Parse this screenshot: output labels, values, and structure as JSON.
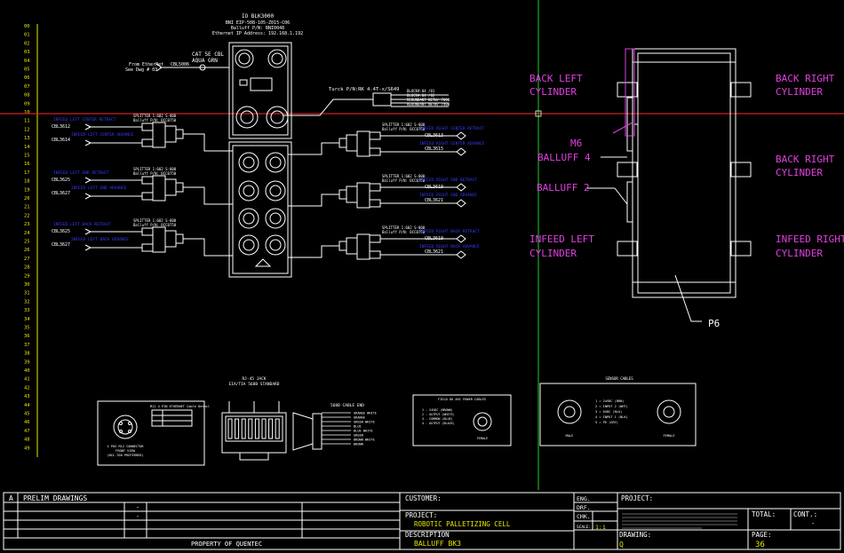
{
  "rows": [
    "00",
    "01",
    "02",
    "03",
    "04",
    "05",
    "06",
    "07",
    "08",
    "09",
    "10",
    "11",
    "12",
    "13",
    "14",
    "15",
    "16",
    "17",
    "18",
    "19",
    "20",
    "21",
    "22",
    "23",
    "24",
    "25",
    "26",
    "27",
    "28",
    "29",
    "30",
    "31",
    "32",
    "33",
    "34",
    "35",
    "36",
    "37",
    "38",
    "39",
    "40",
    "41",
    "42",
    "43",
    "44",
    "45",
    "46",
    "47",
    "48",
    "49"
  ],
  "block_header": [
    "IO BLK3000",
    "BNI EIP-508-105-Z015-C06",
    "Balluff P/N: BNI0048",
    "Ethernet IP Address: 192.168.1.192"
  ],
  "cat_cable": [
    "CAT 5E CBL",
    "AQUA GRN"
  ],
  "from_enet": [
    "From EtherNet",
    "See Dwg # 03"
  ],
  "from_cbl": "CBL5006",
  "turck_cable": "Turck P/N:RK 4.4T-x/S649",
  "turck_notes": [
    "BLOCK#:04 /01",
    "BLOCK#:04 /02",
    "REDUNDANT NETW/ 7000",
    "REDUNDANT NETW/ 7400"
  ],
  "left_groups": [
    {
      "splitter": "SPLITTER 1:602 S-800",
      "pn": "Balluff P/N: BCC0750",
      "desc1": "INFEED LEFT CENTER RETRACT",
      "cbl1": "CBL3612",
      "desc2": "INFEED LEFT CENTER ADVANCE",
      "cbl2": "CBL3614"
    },
    {
      "splitter": "SPLITTER 1:602 S-800",
      "pn": "Balluff P/N: BCC0750",
      "desc1": "INFEED LEFT END RETRACT",
      "cbl1": "CBL3625",
      "desc2": "INFEED LEFT END ADVANCE",
      "cbl2": "CBL3627"
    },
    {
      "splitter": "SPLITTER 1:602 S-800",
      "pn": "Balluff P/N: BCC0750",
      "desc1": "INFEED LEFT BACK RETRACT",
      "cbl1": "CBL3625",
      "desc2": "INFEED LEFT BACK ADVANCE",
      "cbl2": "CBL3627"
    }
  ],
  "right_groups": [
    {
      "splitter": "SPLITTER 1:602 S-800",
      "pn": "Balluff P/N: BCC0750",
      "desc1": "INFEED RIGHT CENTER RETRACT",
      "cbl1": "CBL3613",
      "desc2": "INFEED RIGHT CENTER ADVANCE",
      "cbl2": "CBL3615"
    },
    {
      "splitter": "SPLITTER 1:602 S-800",
      "pn": "Balluff P/N: BCC0750",
      "desc1": "INFEED RIGHT END RETRACT",
      "cbl1": "CBL3619",
      "desc2": "INFEED RIGHT END ADVANCE",
      "cbl2": "CBL3621"
    },
    {
      "splitter": "SPLITTER 1:602 S-800",
      "pn": "Balluff P/N: BCC0750",
      "desc1": "INFEED RIGHT BACK RETRACT",
      "cbl1": "CBL3619",
      "desc2": "INFEED RIGHT BACK ADVANCE",
      "cbl2": "CBL3621"
    }
  ],
  "pallet_labels": {
    "back_left": [
      "BACK LEFT",
      "CYLINDER"
    ],
    "back_right": [
      "BACK RIGHT",
      "CYLINDER"
    ],
    "back_right2": [
      "BACK RIGHT",
      "CYLINDER"
    ],
    "infeed_left": [
      "INFEED LEFT",
      "CYLINDER"
    ],
    "infeed_right": [
      "INFEED RIGHT",
      "CYLINDER"
    ],
    "m6": "M6",
    "balluff4": "BALLUFF 4",
    "balluff2": "BALLUFF 2",
    "p6": "P6"
  },
  "rj45": {
    "title": [
      "RJ-45 JACK",
      "EIA/TIA 568B STANDARD"
    ],
    "pins": [
      "ORANGE WHITE",
      "ORANGE",
      "GREEN WHITE",
      "BLUE",
      "BLUE WHITE",
      "GREEN",
      "BROWN WHITE",
      "BROWN"
    ],
    "cable_end": "568B CABLE END"
  },
  "m12_box": {
    "legend": "M12 4 PIN ETHERNET Cable Detail",
    "caption": [
      "4 POS M12 CONNECTOR",
      "FRONT VIEW",
      "(NCL-700 PREFERRED)"
    ]
  },
  "field_box": {
    "title": "FIELD DO ARC POWER CABLES",
    "rows": [
      "1 - 24VDC (BROWN)",
      "2 - OUTPUT (WHITE)",
      "3 - COMMON (BLUE)",
      "4 - OUTPUT (BLACK)"
    ],
    "caption": "FEMALE"
  },
  "sensor_box": {
    "title": "SENSOR CABLES",
    "rows": [
      "1 = 24VDC (BRN)",
      "2 = INPUT 2 (WHT)",
      "3 = 0VDC (BLU)",
      "4 = INPUT 1 (BLK)",
      "5 = PE (GRY)"
    ],
    "male": "MALE",
    "female": "FEMALE"
  },
  "title_block": {
    "rev_letter": "A",
    "rev_desc": "PRELIM DRAWINGS",
    "property": "PROPERTY OF QUENTEC",
    "customer_label": "CUSTOMER:",
    "project_label": "PROJECT:",
    "project_value": "ROBOTIC PALLETIZING CELL",
    "description_label": "DESCRIPTION",
    "description_value": "BALLUFF BK3",
    "eng": "ENG.",
    "drf": "DRF.",
    "chk": "CHK.",
    "scale": "SCALE:",
    "scale_val": "1:1",
    "drawing_label": "DRAWING:",
    "drawing_value": "Q",
    "project2_label": "PROJECT:",
    "total_label": "TOTAL:",
    "cont_label": "CONT.:",
    "page_label": "PAGE:",
    "page_value": "36",
    "dash": "-"
  }
}
